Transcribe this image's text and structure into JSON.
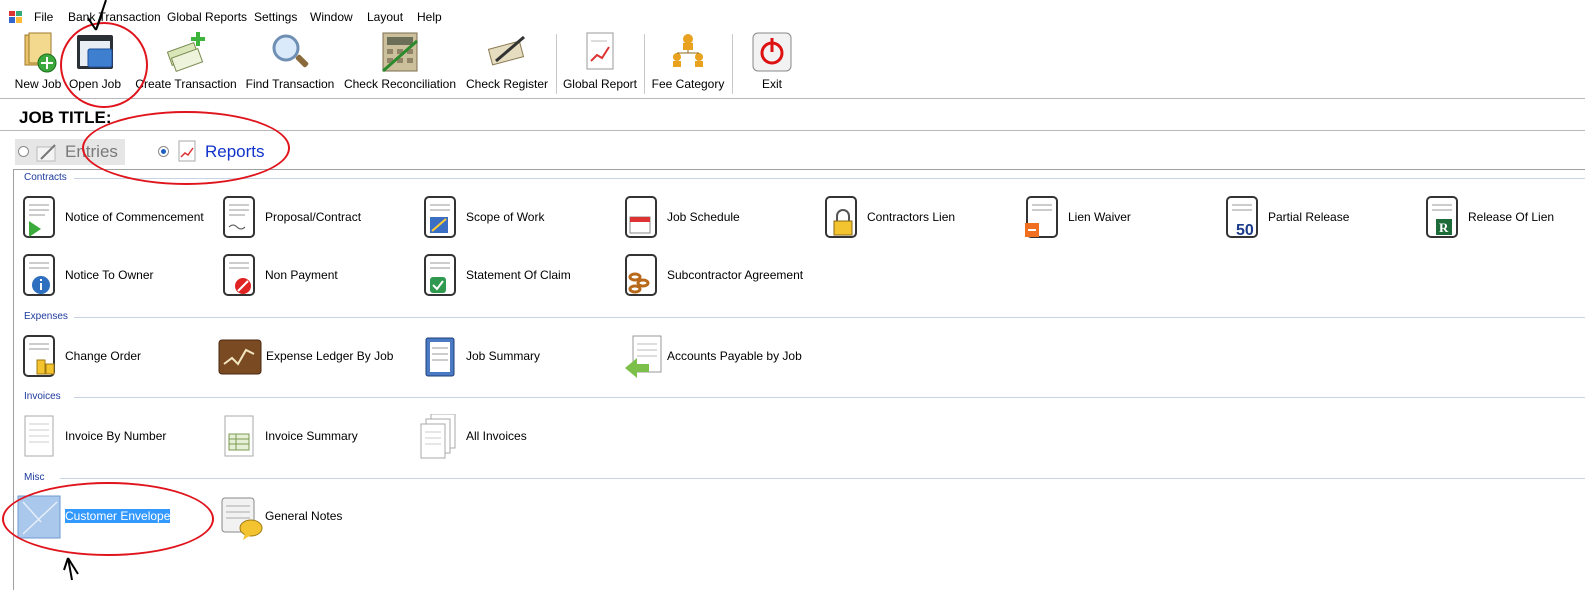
{
  "menu": [
    "File",
    "Bank Transaction",
    "Global Reports",
    "Settings",
    "Window",
    "Layout",
    "Help"
  ],
  "toolbar": {
    "new_job": "New Job",
    "open_job": "Open Job",
    "create_transaction": "Create Transaction",
    "find_transaction": "Find Transaction",
    "check_reconciliation": "Check Reconciliation",
    "check_register": "Check Register",
    "global_report": "Global Report",
    "fee_category": "Fee Category",
    "exit": "Exit"
  },
  "job_title": "JOB TITLE:",
  "mode": {
    "entries": "Entries",
    "reports": "Reports",
    "selected": "Reports"
  },
  "groups": {
    "contracts": {
      "label": "Contracts",
      "items": [
        "Notice of Commencement",
        "Proposal/Contract",
        "Scope of Work",
        "Job Schedule",
        "Contractors Lien",
        "Lien Waiver",
        "Partial Release",
        "Release Of Lien",
        "Notice To Owner",
        "Non Payment",
        "Statement Of Claim",
        "Subcontractor Agreement"
      ]
    },
    "expenses": {
      "label": "Expenses",
      "items": [
        "Change Order",
        "Expense Ledger By Job",
        "Job Summary",
        "Accounts Payable by Job"
      ]
    },
    "invoices": {
      "label": "Invoices",
      "items": [
        "Invoice By Number",
        "Invoice Summary",
        "All Invoices"
      ]
    },
    "misc": {
      "label": "Misc",
      "items": [
        "Customer Envelope",
        "General Notes"
      ],
      "selected": "Customer Envelope"
    }
  },
  "badge_text": {
    "partial_release": "50",
    "release_of_lien": "R"
  },
  "colors": {
    "selection": "#3399ff",
    "annotation": "#e0141c",
    "group_label": "#1c3a9e"
  }
}
